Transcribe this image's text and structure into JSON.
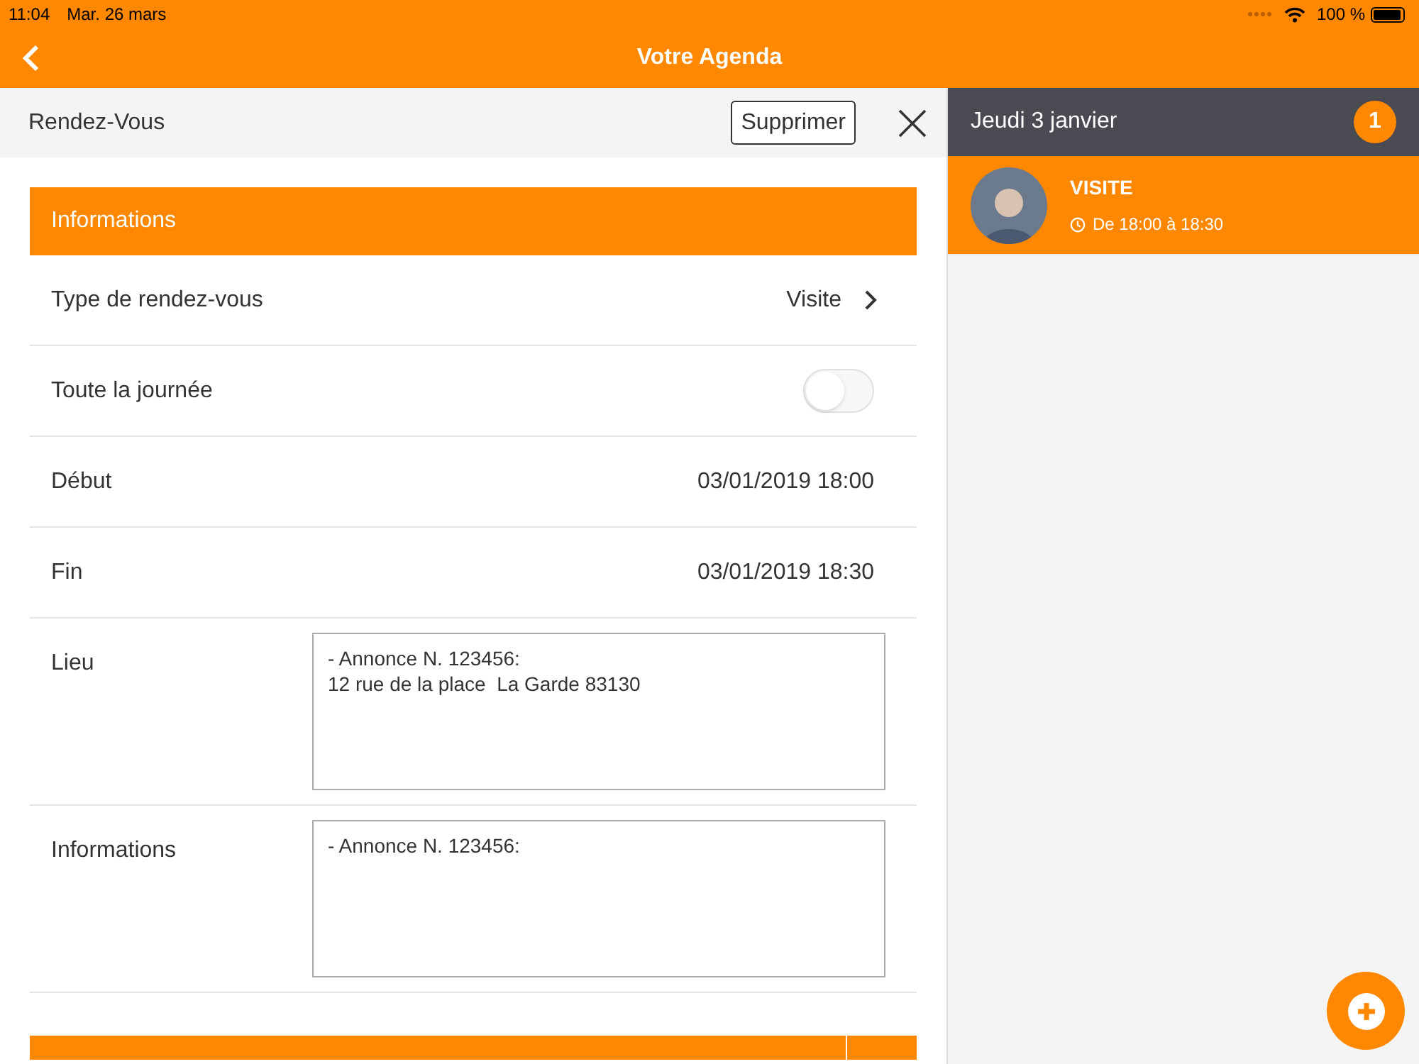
{
  "status_bar": {
    "time": "11:04",
    "date": "Mar. 26 mars",
    "battery": "100 %"
  },
  "header": {
    "title": "Votre Agenda"
  },
  "form": {
    "title": "Rendez-Vous",
    "delete_button": "Supprimer",
    "section_title": "Informations",
    "rows": [
      {
        "kind": "select",
        "label": "Type de rendez-vous",
        "value": "Visite"
      },
      {
        "kind": "toggle",
        "label": "Toute la journée",
        "on": false
      },
      {
        "kind": "value",
        "label": "Début",
        "value": "03/01/2019 18:00"
      },
      {
        "kind": "value",
        "label": "Fin",
        "value": "03/01/2019 18:30"
      },
      {
        "kind": "textarea",
        "label": "Lieu",
        "value": "- Annonce N. 123456:\n12 rue de la place  La Garde 83130"
      },
      {
        "kind": "textarea",
        "label": "Informations",
        "value": "- Annonce N. 123456:"
      }
    ]
  },
  "day": {
    "title": "Jeudi 3 janvier",
    "count": "1",
    "events": [
      {
        "title": "VISITE",
        "time": "De 18:00 à 18:30"
      }
    ]
  }
}
